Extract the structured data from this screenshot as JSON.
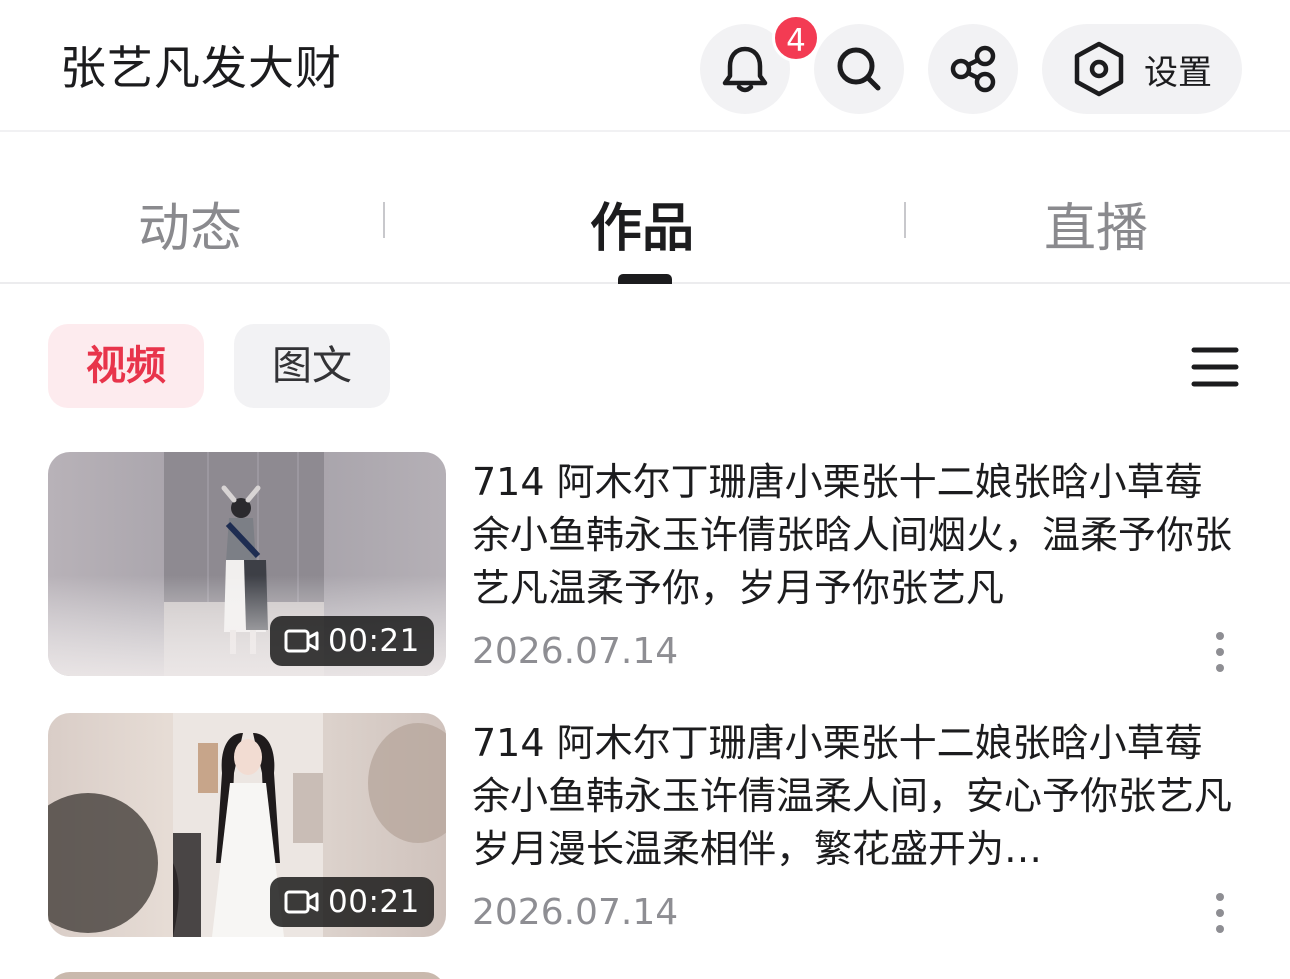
{
  "header": {
    "title": "张艺凡发大财",
    "notification_count": "4",
    "settings_label": "设置"
  },
  "tabs": [
    {
      "label": "动态",
      "active": false
    },
    {
      "label": "作品",
      "active": true
    },
    {
      "label": "直播",
      "active": false
    }
  ],
  "filters": {
    "video_label": "视频",
    "text_label": "图文",
    "selected": "视频"
  },
  "videos": [
    {
      "title": "714 阿木尔丁珊唐小栗张十二娘张晗小草莓余小鱼韩永玉许倩张晗人间烟火，温柔予你张艺凡温柔予你，岁月予你张艺凡",
      "date": "2026.07.14",
      "duration": "00:21"
    },
    {
      "title": "714 阿木尔丁珊唐小栗张十二娘张晗小草莓余小鱼韩永玉许倩温柔人间，安心予你张艺凡岁月漫长温柔相伴，繁花盛开为…",
      "date": "2026.07.14",
      "duration": "00:21"
    }
  ],
  "colors": {
    "accent": "#e8344b",
    "badge": "#f33b53",
    "chip_active_bg": "#fdebee",
    "chip_bg": "#f2f2f4",
    "muted_text": "#8e8e93"
  },
  "icons": [
    "bell-icon",
    "search-icon",
    "share-icon",
    "settings-hexagon-icon",
    "menu-icon",
    "video-camera-icon",
    "more-vertical-icon"
  ]
}
